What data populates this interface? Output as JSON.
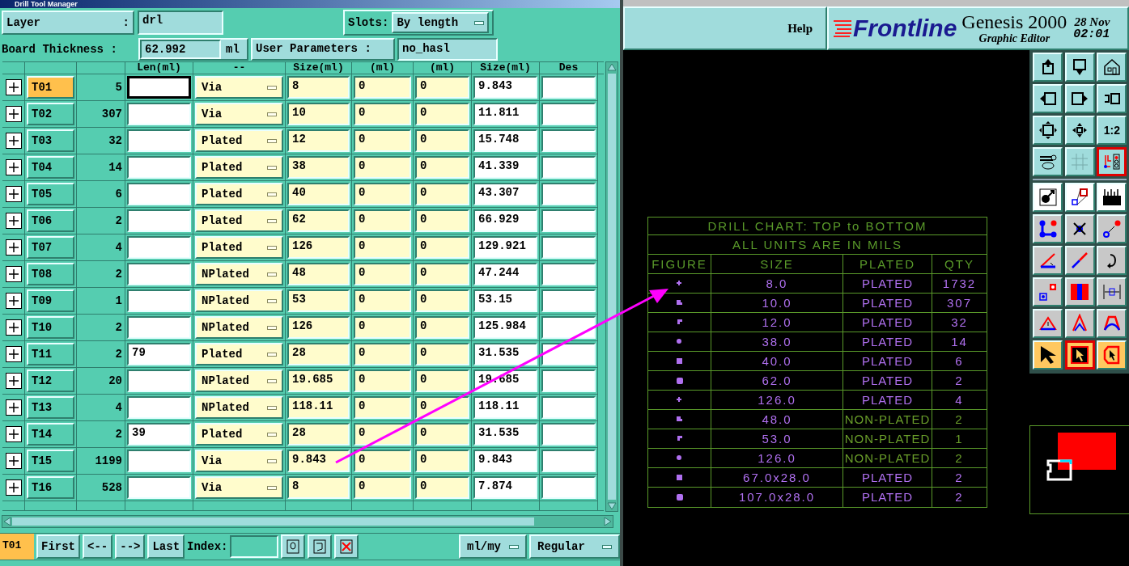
{
  "window": {
    "title": "Drill Tool Manager"
  },
  "layer": {
    "label": "Layer",
    "colon": ":",
    "value": "drl"
  },
  "slots": {
    "label": "Slots:",
    "value": "By length"
  },
  "board_thickness": {
    "label": "Board Thickness :",
    "value": "62.992",
    "unit": "ml"
  },
  "user_parameters": {
    "label": "User Parameters :",
    "value": "no_hasl"
  },
  "table": {
    "columns": [
      "Len(ml)",
      "--",
      "Size(ml)",
      "(ml)",
      "(ml)",
      "Size(ml)",
      "Des"
    ],
    "rows": [
      {
        "name": "T01",
        "count": "5",
        "type": "Via",
        "size": "8",
        "col_6": "0",
        "col_7": "0",
        "finish": "9.843",
        "selected": true
      },
      {
        "name": "T02",
        "count": "307",
        "type": "Via",
        "size": "10",
        "col_6": "0",
        "col_7": "0",
        "finish": "11.811",
        "selected": false
      },
      {
        "name": "T03",
        "count": "32",
        "type": "Plated",
        "size": "12",
        "col_6": "0",
        "col_7": "0",
        "finish": "15.748",
        "selected": false
      },
      {
        "name": "T04",
        "count": "14",
        "type": "Plated",
        "size": "38",
        "col_6": "0",
        "col_7": "0",
        "finish": "41.339",
        "selected": false
      },
      {
        "name": "T05",
        "count": "6",
        "type": "Plated",
        "size": "40",
        "col_6": "0",
        "col_7": "0",
        "finish": "43.307",
        "selected": false
      },
      {
        "name": "T06",
        "count": "2",
        "type": "Plated",
        "size": "62",
        "col_6": "0",
        "col_7": "0",
        "finish": "66.929",
        "selected": false
      },
      {
        "name": "T07",
        "count": "4",
        "type": "Plated",
        "size": "126",
        "col_6": "0",
        "col_7": "0",
        "finish": "129.921",
        "selected": false
      },
      {
        "name": "T08",
        "count": "2",
        "type": "NPlated",
        "size": "48",
        "col_6": "0",
        "col_7": "0",
        "finish": "47.244",
        "selected": false
      },
      {
        "name": "T09",
        "count": "1",
        "type": "NPlated",
        "size": "53",
        "col_6": "0",
        "col_7": "0",
        "finish": "53.15",
        "selected": false
      },
      {
        "name": "T10",
        "count": "2",
        "type": "NPlated",
        "size": "126",
        "col_6": "0",
        "col_7": "0",
        "finish": "125.984",
        "selected": false
      },
      {
        "name": "T11",
        "count": "2",
        "len": "79",
        "type": "Plated",
        "size": "28",
        "col_6": "0",
        "col_7": "0",
        "finish": "31.535",
        "selected": false
      },
      {
        "name": "T12",
        "count": "20",
        "type": "NPlated",
        "size": "19.685",
        "col_6": "0",
        "col_7": "0",
        "finish": "19.685",
        "selected": false
      },
      {
        "name": "T13",
        "count": "4",
        "type": "NPlated",
        "size": "118.11",
        "col_6": "0",
        "col_7": "0",
        "finish": "118.11",
        "selected": false
      },
      {
        "name": "T14",
        "count": "2",
        "len": "39",
        "type": "Plated",
        "size": "28",
        "col_6": "0",
        "col_7": "0",
        "finish": "31.535",
        "selected": false
      },
      {
        "name": "T15",
        "count": "1199",
        "type": "Via",
        "size": "9.843",
        "col_6": "0",
        "col_7": "0",
        "finish": "9.843",
        "selected": false
      },
      {
        "name": "T16",
        "count": "528",
        "type": "Via",
        "size": "8",
        "col_6": "0",
        "col_7": "0",
        "finish": "7.874",
        "selected": false
      }
    ]
  },
  "bottom_bar": {
    "current": "T01",
    "buttons": [
      "First",
      "<--",
      "-->",
      "Last"
    ],
    "index_label": "Index:",
    "units": "ml/my",
    "mode": "Regular"
  },
  "header": {
    "help": "Help",
    "logo": "Frontline",
    "product": "Genesis 2000",
    "subtitle": "Graphic Editor",
    "date": "28 Nov",
    "time": "02:01"
  },
  "drill_chart": {
    "title": "DRILL CHART: TOP to BOTTOM",
    "subtitle": "ALL UNITS ARE IN MILS",
    "columns": [
      "FIGURE",
      "SIZE",
      "PLATED",
      "QTY"
    ],
    "rows": [
      {
        "size": "8.0",
        "plated": "PLATED",
        "qty": "1732",
        "color": "#b070f0"
      },
      {
        "size": "10.0",
        "plated": "PLATED",
        "qty": "307",
        "color": "#b070f0"
      },
      {
        "size": "12.0",
        "plated": "PLATED",
        "qty": "32",
        "color": "#b070f0"
      },
      {
        "size": "38.0",
        "plated": "PLATED",
        "qty": "14",
        "color": "#b070f0"
      },
      {
        "size": "40.0",
        "plated": "PLATED",
        "qty": "6",
        "color": "#b070f0"
      },
      {
        "size": "62.0",
        "plated": "PLATED",
        "qty": "2",
        "color": "#b070f0"
      },
      {
        "size": "126.0",
        "plated": "PLATED",
        "qty": "4",
        "color": "#b070f0"
      },
      {
        "size": "48.0",
        "plated": "NON-PLATED",
        "qty": "2",
        "color": "#6a9e2a"
      },
      {
        "size": "53.0",
        "plated": "NON-PLATED",
        "qty": "1",
        "color": "#6a9e2a"
      },
      {
        "size": "126.0",
        "plated": "NON-PLATED",
        "qty": "2",
        "color": "#6a9e2a"
      },
      {
        "size": "67.0x28.0",
        "plated": "PLATED",
        "qty": "2",
        "color": "#b070f0"
      },
      {
        "size": "107.0x28.0",
        "plated": "PLATED",
        "qty": "2",
        "color": "#b070f0"
      }
    ]
  },
  "tool_buttons": [
    {
      "selected": false
    },
    {
      "selected": false
    },
    {
      "selected": false
    },
    {
      "selected": false
    },
    {
      "selected": false
    },
    {
      "selected": false
    },
    {
      "selected": false
    },
    {
      "selected": false
    },
    {
      "label": "1:2",
      "selected": false
    },
    {
      "selected": false
    },
    {
      "selected": false
    },
    {
      "selected": true
    },
    {
      "selected": false
    },
    {
      "selected": false
    },
    {
      "selected": false
    },
    {
      "selected": false
    },
    {
      "selected": false
    },
    {
      "selected": false
    },
    {
      "selected": false
    },
    {
      "selected": false
    },
    {
      "selected": false
    },
    {
      "selected": false
    },
    {
      "selected": false
    },
    {
      "selected": false
    },
    {
      "selected": false
    },
    {
      "selected": false
    },
    {
      "selected": false
    },
    {
      "selected": false
    },
    {
      "selected": true
    },
    {
      "selected": false
    }
  ]
}
